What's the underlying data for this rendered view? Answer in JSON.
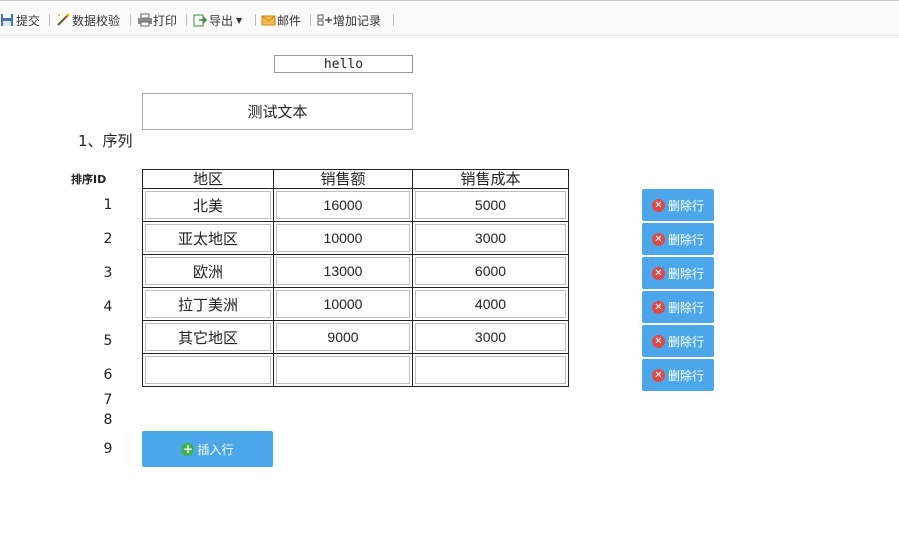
{
  "toolbar": {
    "submit": "提交",
    "validate": "数据校验",
    "print": "打印",
    "export": "导出",
    "mail": "邮件",
    "add_record": "增加记录"
  },
  "hello_text": "hello",
  "test_text": "测试文本",
  "section_title": "1、序列",
  "sort_id_label": "排序ID",
  "table": {
    "headers": [
      "地区",
      "销售额",
      "销售成本"
    ],
    "rows": [
      [
        "北美",
        "16000",
        "5000"
      ],
      [
        "亚太地区",
        "10000",
        "3000"
      ],
      [
        "欧洲",
        "13000",
        "6000"
      ],
      [
        "拉丁美洲",
        "10000",
        "4000"
      ],
      [
        "其它地区",
        "9000",
        "3000"
      ],
      [
        "",
        "",
        ""
      ]
    ]
  },
  "row_numbers": [
    "1",
    "2",
    "3",
    "4",
    "5",
    "6",
    "7",
    "8",
    "9"
  ],
  "delete_label": "删除行",
  "insert_label": "插入行",
  "colors": {
    "button_blue": "#4ba7ea",
    "delete_red": "#e04848",
    "insert_green": "#3fb44a"
  }
}
